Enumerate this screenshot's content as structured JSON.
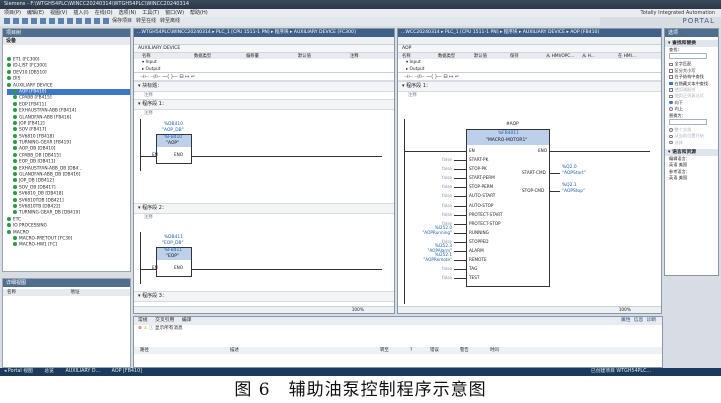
{
  "app": {
    "title": "Siemens - F:\\WTGH54PLC\\WINCC20240314\\WTGH54PLC\\WINCC20240314",
    "brand_line1": "Totally Integrated Automation",
    "brand_line2": "PORTAL",
    "menus": [
      "项目(P)",
      "编辑(E)",
      "视图(V)",
      "插入(I)",
      "在线(O)",
      "选项(N)",
      "工具(T)",
      "窗口(W)",
      "帮助(H)"
    ],
    "toolbar": [
      "保存项目",
      "转至在线",
      "转至离线"
    ]
  },
  "tree": {
    "panel_title": "项目树",
    "section": "设备",
    "items": [
      {
        "label": "ET1 [FC300]",
        "level": 1
      },
      {
        "label": "ID-LIST [FC300]",
        "level": 1
      },
      {
        "label": "DEV10 [DB510]",
        "level": 1
      },
      {
        "label": "DIS",
        "level": 1
      },
      {
        "label": "AUXILIARY DEVICE",
        "level": 1
      },
      {
        "label": "AOP [FB410]",
        "level": 2,
        "selected": true
      },
      {
        "label": "CPABB [FB415]",
        "level": 2
      },
      {
        "label": "EOP [FB411]",
        "level": 2
      },
      {
        "label": "EXHAUSTFAN-ABB [FB414]",
        "level": 2
      },
      {
        "label": "GLANDFAN-ABB [FB416]",
        "level": 2
      },
      {
        "label": "JOP [FB412]",
        "level": 2
      },
      {
        "label": "SOV [FB417]",
        "level": 2
      },
      {
        "label": "SV6810 [FB418]",
        "level": 2
      },
      {
        "label": "TURNING-GEAR [FB419]",
        "level": 2
      },
      {
        "label": "AOP_DB [DB410]",
        "level": 2
      },
      {
        "label": "CPABB_DB [DB415]",
        "level": 2
      },
      {
        "label": "EOP_DB [DB411]",
        "level": 2
      },
      {
        "label": "EXHAUSTFAN-ABB_DB [DB4...",
        "level": 2
      },
      {
        "label": "GLANDFAN-ABB_DB [DB416]",
        "level": 2
      },
      {
        "label": "JOP_DB [DB412]",
        "level": 2
      },
      {
        "label": "SOV_DB [DB417]",
        "level": 2
      },
      {
        "label": "SV6810_DB [DB418]",
        "level": 2
      },
      {
        "label": "SV6810TDB [DB421]",
        "level": 2
      },
      {
        "label": "SV6810TB [DB422]",
        "level": 2
      },
      {
        "label": "TURNING-GEAR_DB [DB419]",
        "level": 2
      },
      {
        "label": "ETC",
        "level": 1
      },
      {
        "label": "IO PROCESSING",
        "level": 1
      },
      {
        "label": "MACRO",
        "level": 1
      },
      {
        "label": "MACRO-PRETOUT [FC30]",
        "level": 2
      },
      {
        "label": "MACRO-HW1 [FC]",
        "level": 2
      }
    ],
    "detail_title": "详细视图",
    "detail_cols": [
      "名称",
      "地址"
    ]
  },
  "left_editor": {
    "title": "...WTGH54PLC\\WINCC20240314 ▸ PLC_1 [CPU 1511-1 PN] ▸ 程序块 ▸ AUXILIARY DEVICE [FC300]",
    "block_name": "AUXILIARY DEVICE",
    "iface_cols": [
      "名称",
      "数据类型",
      "偏移量",
      "默认值",
      "注释"
    ],
    "iface_rows": [
      "▾ Input",
      "▸ Output"
    ],
    "segments": [
      {
        "label": "▾ 块标题：",
        "note": "注释"
      },
      {
        "label": "▾ 程序段 1：",
        "note": "注释",
        "operand": "%DB410",
        "operand_name": "\"AOP_DB\"",
        "fb_ref": "%FB410",
        "fb_name": "\"AOP\"",
        "en": "EN",
        "eno": "ENO"
      },
      {
        "label": "▾ 程序段 2：",
        "note": "注释",
        "operand": "%DB411",
        "operand_name": "\"EOP_DB\"",
        "fb_ref": "%FB411",
        "fb_name": "\"EOP\"",
        "en": "EN",
        "eno": "ENO"
      },
      {
        "label": "▾ 程序段 3：",
        "note": "注释"
      }
    ],
    "zoom": "100%"
  },
  "right_editor": {
    "title": "...WCC20240314 ▸ PLC_1 [CPU 1511-1 PN] ▸ 程序块 ▸ AUXILIARY DEVICE ▸ AOP [FB410]",
    "block_name": "AOP",
    "iface_cols": [
      "名称",
      "数据类型",
      "默认值",
      "保持",
      "从 HMI/OPC...",
      "从 H...",
      "在 HMI..."
    ],
    "iface_rows": [
      "▾ Input",
      "▸ Output"
    ],
    "segment": {
      "label": "▾ 程序段 1：",
      "note": "注释"
    },
    "fb": {
      "instance": "#AOP",
      "ref": "%FB4011",
      "name": "\"MACRO-MOTOR1\"",
      "en": "EN",
      "eno": "ENO",
      "inputs": [
        {
          "pin": "START-PK",
          "value": "false"
        },
        {
          "pin": "STOP-PK",
          "value": "false"
        },
        {
          "pin": "START-PERM",
          "value": "false"
        },
        {
          "pin": "STOP-PERM",
          "value": "false"
        },
        {
          "pin": "AUTO-START",
          "value": "false"
        },
        {
          "pin": "AUTO-STOP",
          "value": "false"
        },
        {
          "pin": "PROTECT-START",
          "value": "false"
        },
        {
          "pin": "PROTECT-STOP",
          "value": "false"
        },
        {
          "pin": "RUNNING",
          "value": "\"AOPRunning\"",
          "addr": "%I252.0"
        },
        {
          "pin": "STOPPED",
          "value": "false"
        },
        {
          "pin": "ALARM",
          "value": "\"AOPAlarm\"",
          "addr": "%I252.3"
        },
        {
          "pin": "REMOTE",
          "value": "\"AOPRemote\"",
          "addr": "%I252.1"
        },
        {
          "pin": "TAG",
          "value": "false"
        },
        {
          "pin": "TEST",
          "value": "false"
        }
      ],
      "outputs": [
        {
          "pin": "START-CMD",
          "addr": "%Q2.0",
          "value": "\"AOPStart\""
        },
        {
          "pin": "STOP-CMD",
          "addr": "%Q2.1",
          "value": "\"AOPStop\""
        }
      ]
    },
    "zoom": "100%"
  },
  "tasks": {
    "title": "选项",
    "section1": "▾ 查找和替换",
    "find_label": "查找：",
    "options": [
      {
        "label": "全字匹配",
        "on": false
      },
      {
        "label": "区分大小写",
        "on": false
      },
      {
        "label": "在子结构中查找",
        "on": false
      },
      {
        "label": "在隐藏文本中查找",
        "on": true
      },
      {
        "label": "使用通配符",
        "on": false,
        "grey": true
      },
      {
        "label": "使用正则表达式",
        "on": false,
        "grey": true
      }
    ],
    "dir_options": [
      "向下",
      "向上"
    ],
    "replace_label": "替换为：",
    "replace_options": [
      "整个文档",
      "从当前位置开始",
      "选择"
    ],
    "section2": "▾ 语言和资源",
    "edit_lang": "编辑语言：",
    "edit_lang_value": "英语 美国",
    "ref_lang": "参考语言：",
    "ref_lang_value": "英语 美国",
    "tabs": [
      "任务",
      "库",
      "测试",
      "指令"
    ]
  },
  "inspector": {
    "tabs": [
      "常规",
      "交叉引用",
      "编译"
    ],
    "filter": "显示所有消息",
    "cols": [
      "路径",
      "描述",
      "转至",
      "?",
      "错误",
      "警告",
      "时间"
    ],
    "props_tabs": [
      "属性",
      "信息",
      "诊断"
    ]
  },
  "taskbar": {
    "portal": "◂ Portal 视图",
    "items": [
      "总览",
      "AUXILIARY D...",
      "AOP [FB410]"
    ],
    "status": "已创建项目 WTGH54PLC..."
  },
  "caption": "图 6　辅助油泵控制程序示意图"
}
